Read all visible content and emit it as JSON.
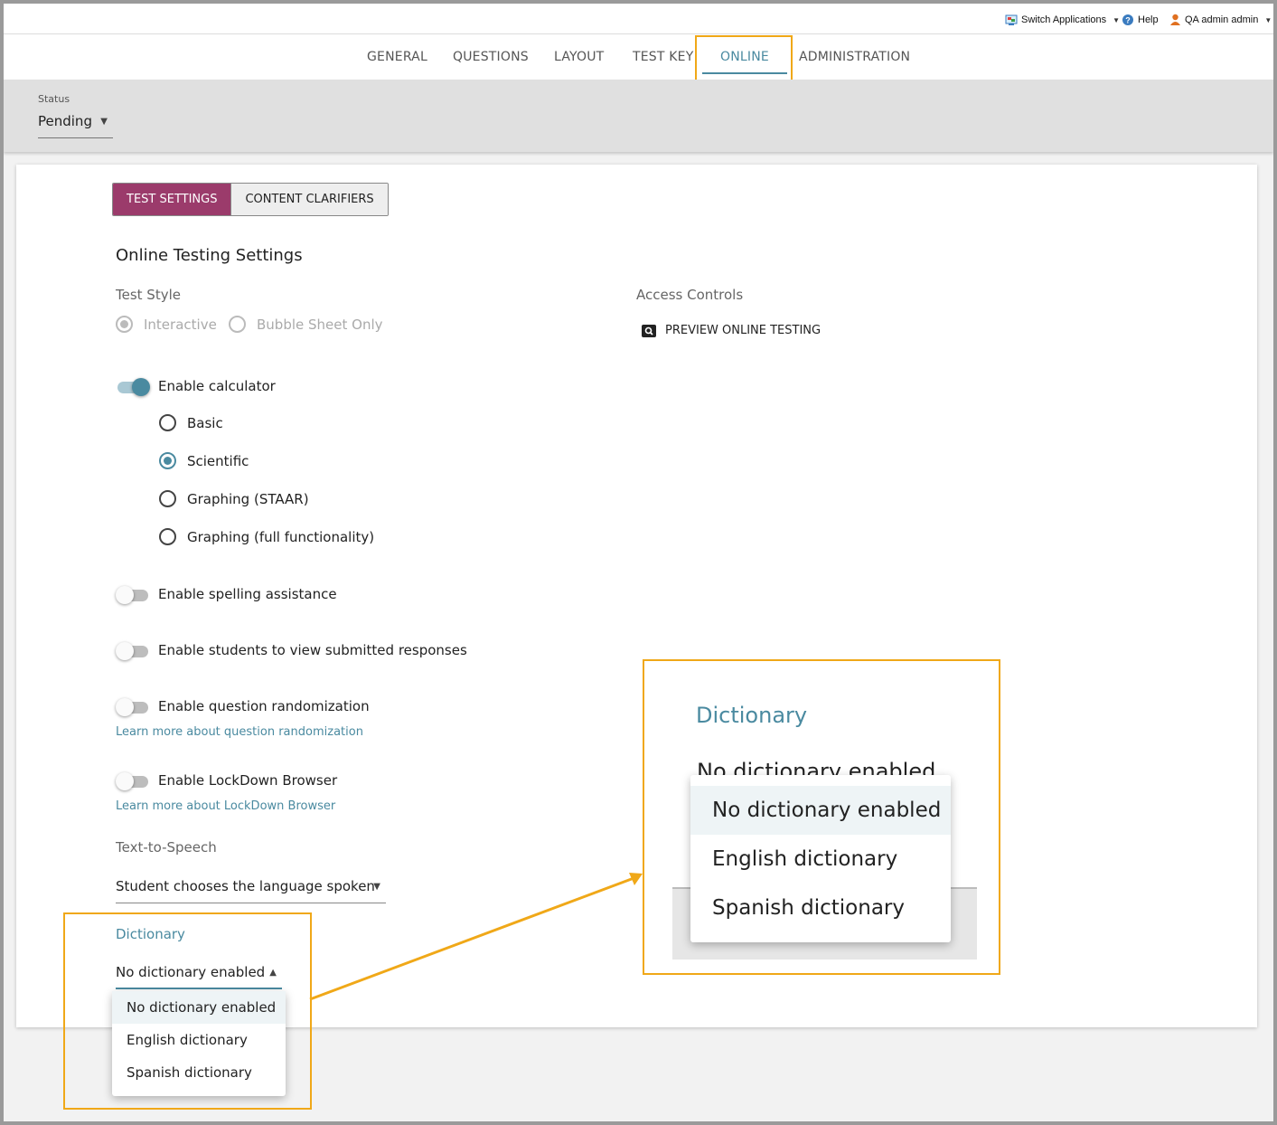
{
  "utility": {
    "switch_apps": "Switch Applications",
    "help": "Help",
    "user": "QA admin admin"
  },
  "tabs": [
    "GENERAL",
    "QUESTIONS",
    "LAYOUT",
    "TEST KEY",
    "ONLINE",
    "ADMINISTRATION"
  ],
  "active_tab": "ONLINE",
  "status": {
    "label": "Status",
    "value": "Pending"
  },
  "subtabs": {
    "settings": "TEST SETTINGS",
    "clarifiers": "CONTENT CLARIFIERS"
  },
  "section_title": "Online Testing Settings",
  "test_style": {
    "label": "Test Style",
    "options": [
      "Interactive",
      "Bubble Sheet Only"
    ],
    "selected": "Interactive"
  },
  "access": {
    "label": "Access Controls",
    "preview": "PREVIEW ONLINE TESTING"
  },
  "calculator": {
    "label": "Enable calculator",
    "enabled": true,
    "options": [
      "Basic",
      "Scientific",
      "Graphing (STAAR)",
      "Graphing (full functionality)"
    ],
    "selected": "Scientific"
  },
  "toggles": {
    "spelling": "Enable spelling assistance",
    "view_responses": "Enable students to view submitted responses",
    "randomization": "Enable question randomization",
    "lockdown": "Enable LockDown Browser"
  },
  "links": {
    "randomization": "Learn more about question randomization",
    "lockdown": "Learn more about LockDown Browser"
  },
  "tts": {
    "label": "Text-to-Speech",
    "value": "Student chooses the language spoken"
  },
  "dictionary": {
    "label": "Dictionary",
    "value": "No dictionary enabled",
    "options": [
      "No dictionary enabled",
      "English dictionary",
      "Spanish dictionary"
    ]
  },
  "colors": {
    "accent": "#4a8aa0",
    "primary": "#9b3b6b",
    "highlight": "#f0a818"
  }
}
